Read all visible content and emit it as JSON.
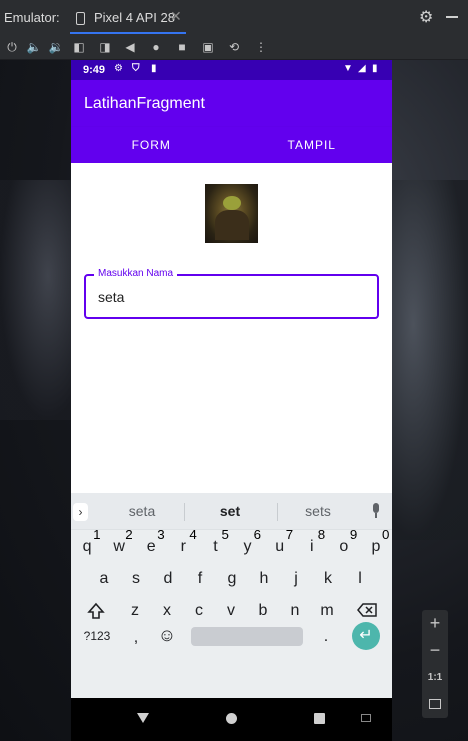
{
  "emulator": {
    "title": "Emulator:",
    "tab_label": "Pixel 4 API 28",
    "tab_close": "✕",
    "toolbar_icons": [
      "power-icon",
      "volume-up-icon",
      "volume-down-icon",
      "rotate-left-icon",
      "rotate-right-icon",
      "back-icon",
      "home-icon",
      "overview-icon",
      "screenshot-icon",
      "snapshot-icon",
      "more-icon"
    ],
    "zoom": {
      "plus": "+",
      "minus": "−",
      "ratio": "1:1"
    }
  },
  "device": {
    "status": {
      "time": "9:49"
    },
    "app": {
      "title": "LatihanFragment"
    },
    "tabs": [
      "FORM",
      "TAMPIL"
    ],
    "form": {
      "name_label": "Masukkan Nama",
      "name_value": "seta"
    },
    "keyboard": {
      "suggestions": [
        "seta",
        "set",
        "sets"
      ],
      "row1": [
        {
          "k": "q",
          "n": "1"
        },
        {
          "k": "w",
          "n": "2"
        },
        {
          "k": "e",
          "n": "3"
        },
        {
          "k": "r",
          "n": "4"
        },
        {
          "k": "t",
          "n": "5"
        },
        {
          "k": "y",
          "n": "6"
        },
        {
          "k": "u",
          "n": "7"
        },
        {
          "k": "i",
          "n": "8"
        },
        {
          "k": "o",
          "n": "9"
        },
        {
          "k": "p",
          "n": "0"
        }
      ],
      "row2": [
        "a",
        "s",
        "d",
        "f",
        "g",
        "h",
        "j",
        "k",
        "l"
      ],
      "row3": [
        "z",
        "x",
        "c",
        "v",
        "b",
        "n",
        "m"
      ],
      "symbols_key": "?123",
      "comma_key": ",",
      "period_key": ".",
      "emoji_key": "☺"
    }
  },
  "colors": {
    "primary": "#6200ee",
    "primary_dark": "#3700b3",
    "enter_key": "#4db6ac"
  }
}
